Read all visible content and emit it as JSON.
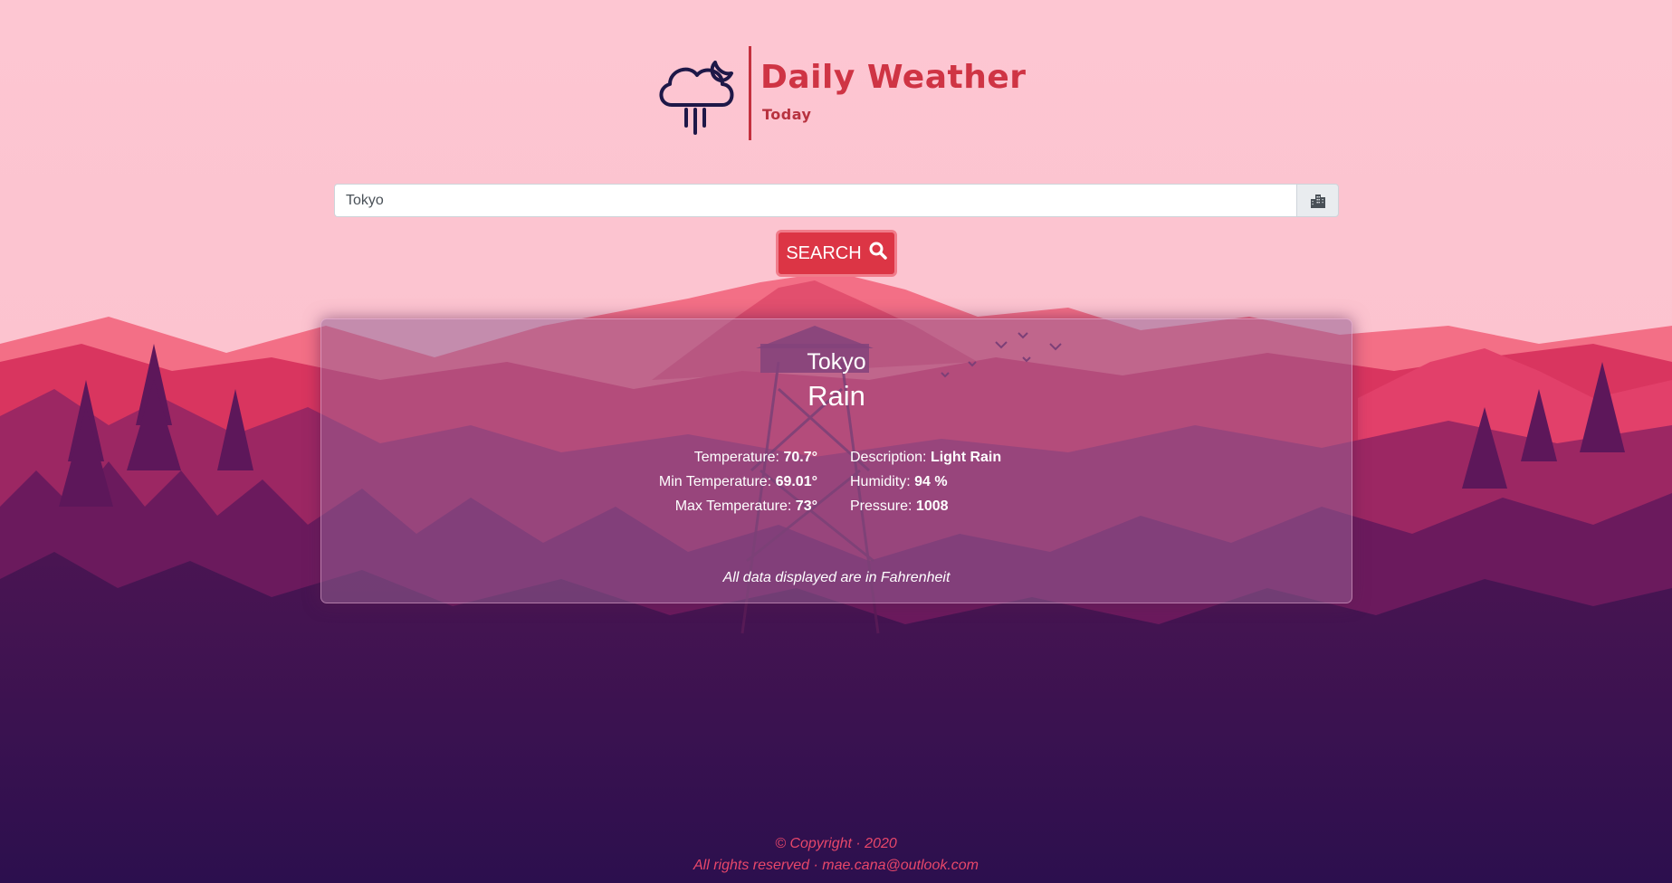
{
  "brand": {
    "title": "Daily Weather",
    "subtitle": "Today",
    "icon": "cloud-moon-rain-icon",
    "accent_color": "#cf3444",
    "icon_color": "#1e1848"
  },
  "search": {
    "value": "Tokyo",
    "addon_icon": "city-icon",
    "button_label": "SEARCH",
    "button_icon": "search-icon",
    "button_color": "#dc3545"
  },
  "weather": {
    "city": "Tokyo",
    "main": "Rain",
    "stats": {
      "temperature": {
        "label": "Temperature:",
        "value": "70.7°"
      },
      "description": {
        "label": "Description:",
        "value": "Light Rain"
      },
      "min_temperature": {
        "label": "Min Temperature:",
        "value": "69.01°"
      },
      "humidity": {
        "label": "Humidity:",
        "value": "94 %"
      },
      "max_temperature": {
        "label": "Max Temperature:",
        "value": "73°"
      },
      "pressure": {
        "label": "Pressure:",
        "value": "1008"
      }
    },
    "note": "All data displayed are in Fahrenheit"
  },
  "footer": {
    "line1": "© Copyright · 2020",
    "line2": "All rights reserved · mae.cana@outlook.com",
    "color": "#e8476a"
  }
}
